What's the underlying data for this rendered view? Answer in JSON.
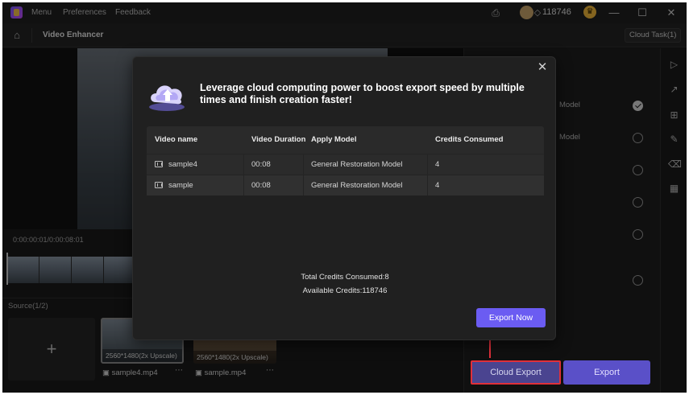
{
  "titlebar": {
    "menus": [
      "Menu",
      "Preferences",
      "Feedback"
    ],
    "credits": "118746"
  },
  "toolbar": {
    "page_title": "Video Enhancer",
    "cloud_task": "Cloud Task(1)"
  },
  "preview": {
    "timecode": "0:00:00:01/0:00:08:01"
  },
  "source": {
    "label": "Source(1/2)",
    "add_symbol": "+",
    "files": [
      {
        "name": "sample4.mp4",
        "badge": "2560*1480(2x Upscale)"
      },
      {
        "name": "sample.mp4",
        "badge": "2560*1480(2x Upscale)"
      }
    ]
  },
  "right_panel": {
    "models": [
      {
        "label": "Model",
        "selected": true
      },
      {
        "label": "Model",
        "selected": false
      },
      {
        "label": "",
        "selected": false
      },
      {
        "label": "",
        "selected": false
      },
      {
        "label": "",
        "selected": false
      },
      {
        "label": "",
        "selected": false
      }
    ],
    "cloud_export": "Cloud Export",
    "export": "Export"
  },
  "modal": {
    "heading": "Leverage cloud computing power to boost export speed by multiple times and finish creation faster!",
    "columns": [
      "Video name",
      "Video Duration",
      "Apply Model",
      "Credits Consumed"
    ],
    "rows": [
      {
        "name": "sample4",
        "duration": "00:08",
        "model": "General Restoration Model",
        "credits": "4"
      },
      {
        "name": "sample",
        "duration": "00:08",
        "model": "General Restoration Model",
        "credits": "4"
      }
    ],
    "total_consumed": "Total Credits Consumed:8",
    "available": "Available Credits:118746",
    "export_now": "Export Now"
  },
  "colors": {
    "accent": "#6b5cf2",
    "highlight": "#e0303a"
  }
}
